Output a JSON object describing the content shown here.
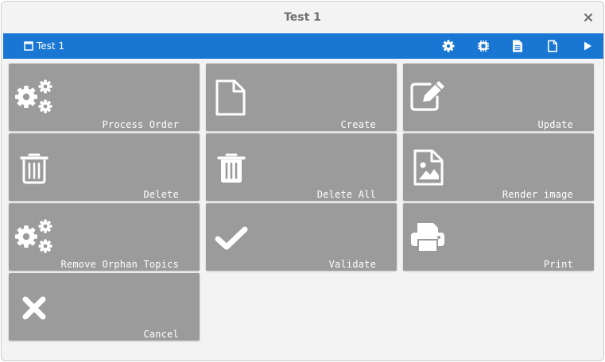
{
  "window": {
    "title": "Test 1",
    "close_icon": "close-icon"
  },
  "toolbar": {
    "tab_label": "Test 1",
    "tab_icon": "window-icon",
    "tools": [
      "gear-icon",
      "chip-icon",
      "document-text-icon",
      "document-icon",
      "play-icon"
    ],
    "color": "#1976d2"
  },
  "tiles": [
    {
      "label": "Process Order",
      "icon": "gears-icon"
    },
    {
      "label": "Create",
      "icon": "file-icon"
    },
    {
      "label": "Update",
      "icon": "edit-icon"
    },
    {
      "label": "Delete",
      "icon": "trash-icon"
    },
    {
      "label": "Delete All",
      "icon": "trash-icon"
    },
    {
      "label": "Render image",
      "icon": "image-file-icon"
    },
    {
      "label": "Remove Orphan Topics",
      "icon": "gears-icon"
    },
    {
      "label": "Validate",
      "icon": "check-icon"
    },
    {
      "label": "Print",
      "icon": "printer-icon"
    },
    {
      "label": "Cancel",
      "icon": "x-icon"
    }
  ],
  "tile_color": "#9b9b9b"
}
